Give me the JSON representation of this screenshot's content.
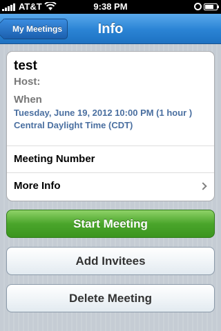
{
  "status_bar": {
    "carrier": "AT&T",
    "time": "9:38 PM",
    "icons": [
      "signal-icon",
      "wifi-icon",
      "alarm-icon",
      "battery-icon"
    ]
  },
  "nav": {
    "back_label": "My Meetings",
    "title": "Info"
  },
  "meeting": {
    "title": "test",
    "host_label": "Host:",
    "when_label": "When",
    "when_value": "Tuesday, June 19, 2012 10:00 PM (1 hour )",
    "timezone": "Central Daylight Time (CDT)",
    "number_label": "Meeting Number",
    "more_info_label": "More Info"
  },
  "actions": {
    "start": "Start Meeting",
    "add_invitees": "Add Invitees",
    "delete": "Delete Meeting"
  },
  "colors": {
    "nav_blue": "#2a83d4",
    "start_green": "#4aa52b",
    "detail_blue": "#4a6fa0"
  }
}
